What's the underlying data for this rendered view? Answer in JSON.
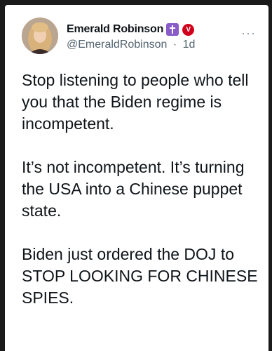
{
  "tweet": {
    "author_name": "Emerald Robinson",
    "handle": "@EmeraldRobinson",
    "separator": "·",
    "time": "1d",
    "badges": {
      "cross_color": "#8a5cc9",
      "verified_letter": "V",
      "verified_color": "#d0021b"
    },
    "paragraphs": [
      "Stop listening to people who tell you that the Biden regime is incompetent.",
      "It’s not incompetent. It’s turning the USA into a Chinese puppet state.",
      "Biden just ordered the DOJ to STOP LOOKING FOR CHINESE SPIES."
    ],
    "more_menu": "···"
  }
}
